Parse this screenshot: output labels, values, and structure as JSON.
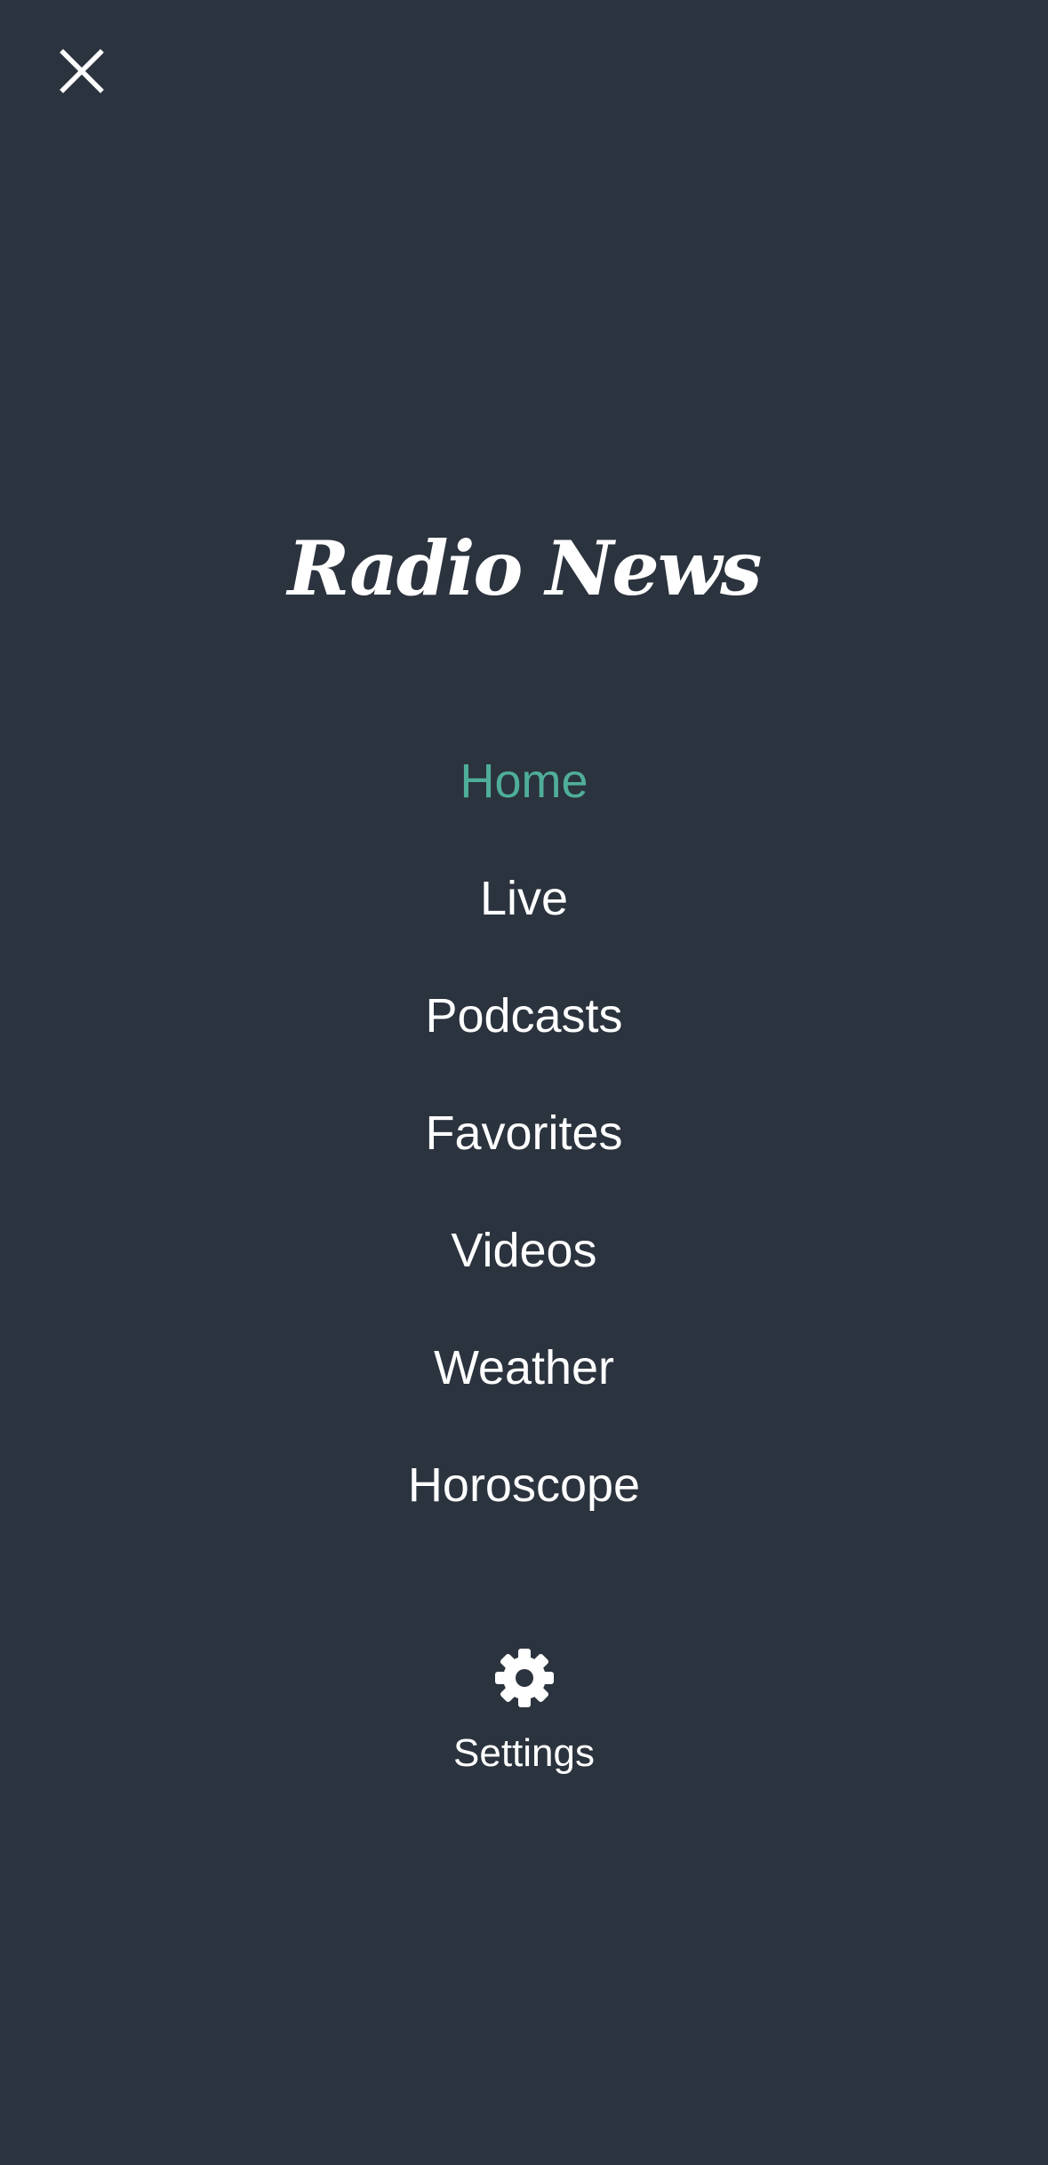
{
  "app": {
    "brand": "Radio News",
    "colors": {
      "background": "#2b333e",
      "accent": "#4fae9a",
      "text": "#ffffff"
    }
  },
  "header": {
    "close_icon": "close-icon"
  },
  "menu": {
    "items": [
      {
        "label": "Home",
        "active": true
      },
      {
        "label": "Live",
        "active": false
      },
      {
        "label": "Podcasts",
        "active": false
      },
      {
        "label": "Favorites",
        "active": false
      },
      {
        "label": "Videos",
        "active": false
      },
      {
        "label": "Weather",
        "active": false
      },
      {
        "label": "Horoscope",
        "active": false
      }
    ]
  },
  "settings": {
    "icon": "gear-icon",
    "label": "Settings"
  }
}
